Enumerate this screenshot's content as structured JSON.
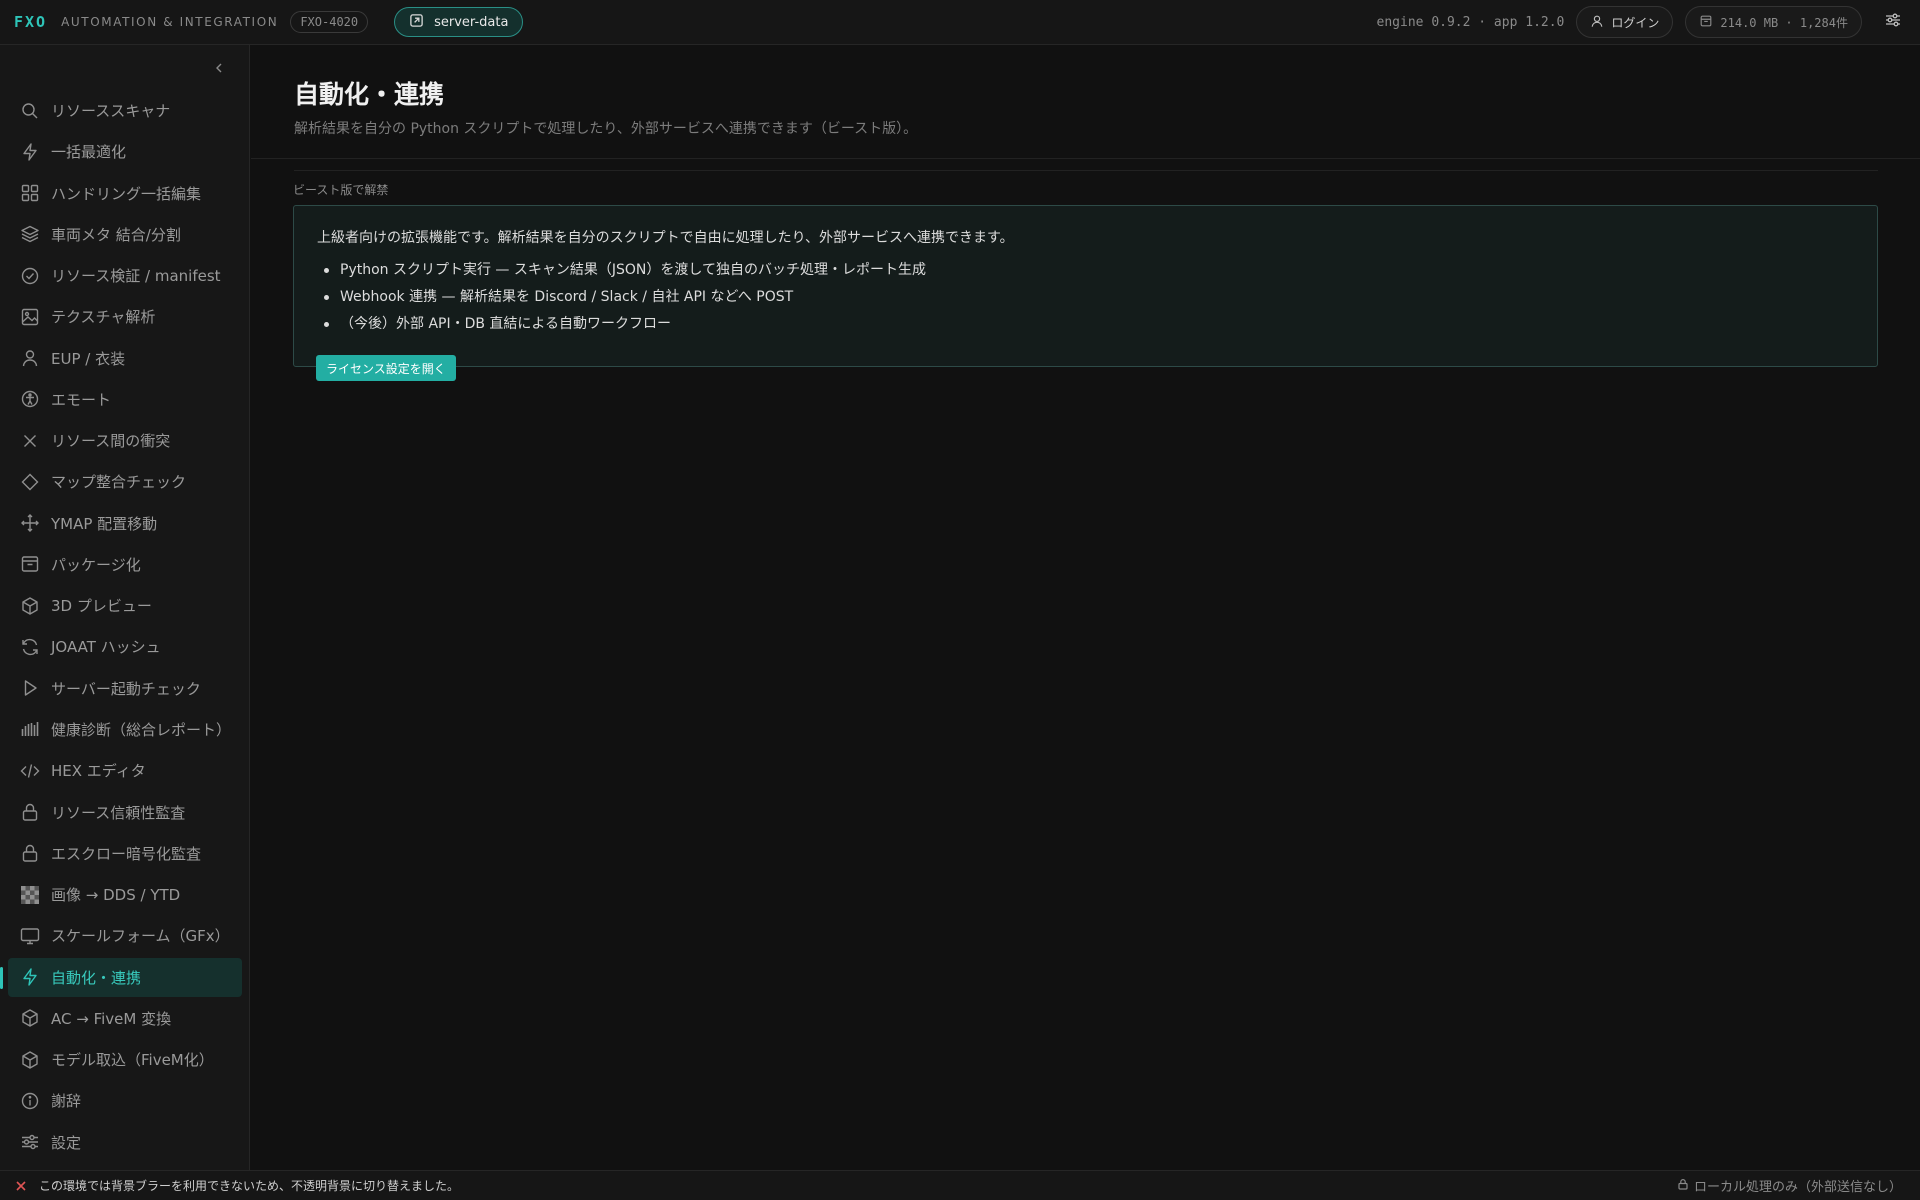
{
  "topbar": {
    "brand": "FXO",
    "brand_sub": "AUTOMATION & INTEGRATION",
    "version_badge": "FXO-4020",
    "project": "server-data",
    "engine_info": "engine 0.9.2 · app 1.2.0",
    "login_label": "ログイン",
    "storage_info": "214.0 MB · 1,284件"
  },
  "sidebar": {
    "items": [
      {
        "label": "リソーススキャナ",
        "icon": "search-icon"
      },
      {
        "label": "一括最適化",
        "icon": "lightning-icon"
      },
      {
        "label": "ハンドリング一括編集",
        "icon": "grid-icon"
      },
      {
        "label": "車両メタ 結合/分割",
        "icon": "layers-icon"
      },
      {
        "label": "リソース検証 / manifest",
        "icon": "check-circle-icon"
      },
      {
        "label": "テクスチャ解析",
        "icon": "image-icon"
      },
      {
        "label": "EUP / 衣装",
        "icon": "user-icon"
      },
      {
        "label": "エモート",
        "icon": "accessibility-icon"
      },
      {
        "label": "リソース間の衝突",
        "icon": "x-icon"
      },
      {
        "label": "マップ整合チェック",
        "icon": "diamond-icon"
      },
      {
        "label": "YMAP 配置移動",
        "icon": "move-icon"
      },
      {
        "label": "パッケージ化",
        "icon": "archive-icon"
      },
      {
        "label": "3D プレビュー",
        "icon": "cube-icon"
      },
      {
        "label": "JOAAT ハッシュ",
        "icon": "refresh-icon"
      },
      {
        "label": "サーバー起動チェック",
        "icon": "play-icon"
      },
      {
        "label": "健康診断（総合レポート）",
        "icon": "bars-icon"
      },
      {
        "label": "HEX エディタ",
        "icon": "code-icon"
      },
      {
        "label": "リソース信頼性監査",
        "icon": "lock-icon"
      },
      {
        "label": "エスクロー暗号化監査",
        "icon": "lock-icon"
      },
      {
        "label": "画像 → DDS / YTD",
        "icon": "checker-icon"
      },
      {
        "label": "スケールフォーム（GFx）",
        "icon": "monitor-icon"
      },
      {
        "label": "自動化・連携",
        "icon": "lightning-icon",
        "active": true
      },
      {
        "label": "AC → FiveM 変換",
        "icon": "cube-icon"
      },
      {
        "label": "モデル取込（FiveM化）",
        "icon": "cube-icon"
      },
      {
        "label": "謝辞",
        "icon": "info-icon"
      },
      {
        "label": "設定",
        "icon": "sliders-icon"
      }
    ]
  },
  "main": {
    "title": "自動化・連携",
    "subtitle": "解析結果を自分の Python スクリプトで処理したり、外部サービスへ連携できます（ビースト版）。",
    "section_label": "ビースト版で解禁",
    "card": {
      "description": "上級者向けの拡張機能です。解析結果を自分のスクリプトで自由に処理したり、外部サービスへ連携できます。",
      "items": [
        "Python スクリプト実行 — スキャン結果（JSON）を渡して独自のバッチ処理・レポート生成",
        "Webhook 連携 — 解析結果を Discord / Slack / 自社 API などへ POST",
        "（今後）外部 API・DB 直結による自動ワークフロー"
      ],
      "button_label": "ライセンス設定を開く"
    }
  },
  "statusbar": {
    "message": "この環境では背景ブラーを利用できないため、不透明背景に切り替えました。",
    "right": "ローカル処理のみ（外部送信なし）"
  },
  "colors": {
    "accent": "#2ec4b8",
    "error": "#e05555",
    "background": "#111111"
  }
}
